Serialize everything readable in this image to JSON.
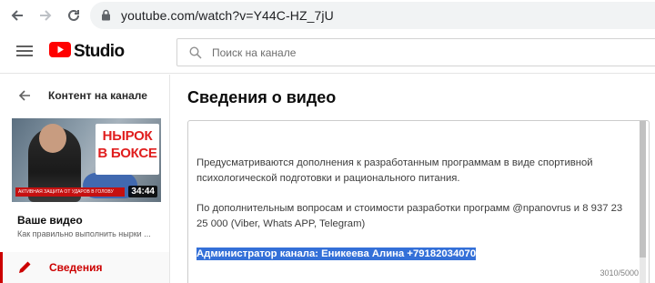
{
  "browser": {
    "url": "youtube.com/watch?v=Y44C-HZ_7jU"
  },
  "header": {
    "logo_text": "Studio",
    "search_placeholder": "Поиск на канале"
  },
  "sidebar": {
    "back_label": "Контент на канале",
    "thumbnail": {
      "title_line1": "НЫРОК",
      "title_line2": "В БОКСЕ",
      "banner": "АКТИВНАЯ ЗАЩИТА ОТ УДАРОВ В ГОЛОВУ",
      "duration": "34:44"
    },
    "video_label": "Ваше видео",
    "video_title": "Как правильно выполнить нырки ...",
    "active_item": "Сведения"
  },
  "main": {
    "page_title": "Сведения о видео",
    "description": {
      "paragraph1": "Предусматриваются дополнения к разработанным программам в виде спортивной психологической подготовки и рационального питания.",
      "paragraph2": "По дополнительным вопросам и стоимости разработки программ @npanovrus и 8 937 23 25 000 (Viber, Whats APP, Telegram)",
      "selected_line": "Администратор канала: Еникеева Алина +79182034070",
      "char_count": "3010/5000"
    }
  },
  "colors": {
    "accent_red": "#cc0000",
    "selection_blue": "#3470d8",
    "youtube_red": "#ff0000"
  }
}
